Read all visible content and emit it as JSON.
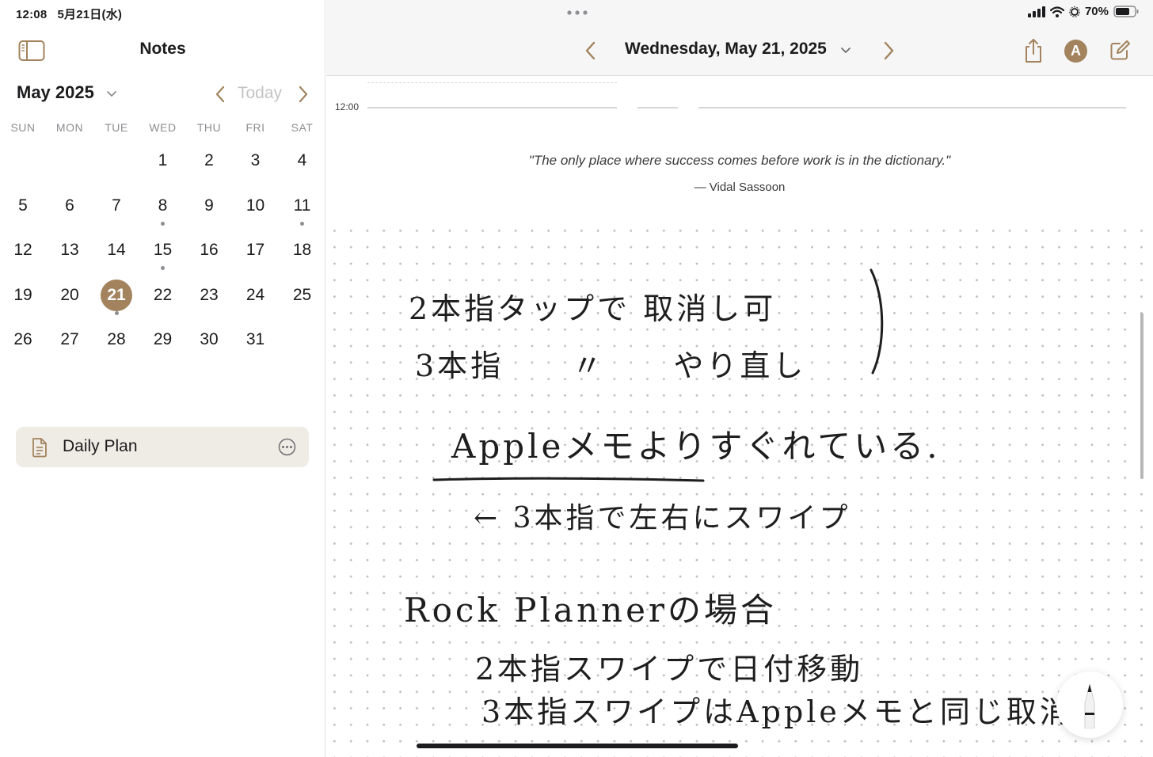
{
  "status_bar": {
    "time": "12:08",
    "date": "5月21日(水)",
    "battery": "70%"
  },
  "sidebar": {
    "title": "Notes",
    "month_label": "May 2025",
    "today_label": "Today",
    "weekdays": [
      "SUN",
      "MON",
      "TUE",
      "WED",
      "THU",
      "FRI",
      "SAT"
    ],
    "weeks": [
      [
        "",
        "",
        "",
        "1",
        "2",
        "3",
        "4"
      ],
      [
        "5",
        "6",
        "7",
        "8",
        "9",
        "10",
        "11"
      ],
      [
        "12",
        "13",
        "14",
        "15",
        "16",
        "17",
        "18"
      ],
      [
        "19",
        "20",
        "21",
        "22",
        "23",
        "24",
        "25"
      ],
      [
        "26",
        "27",
        "28",
        "29",
        "30",
        "31",
        ""
      ]
    ],
    "selected_day": "21",
    "days_with_dots": [
      "8",
      "11",
      "15",
      "21"
    ],
    "plan_item": {
      "label": "Daily Plan"
    }
  },
  "header": {
    "date": "Wednesday, May 21, 2025",
    "avatar_letter": "A"
  },
  "note": {
    "time_label": "12:00",
    "quote": "\"The only place where success comes before work is in the dictionary.\"",
    "quote_author": "— Vidal Sassoon",
    "handwriting": [
      "2本指タップで 取消し可",
      "3本指 〃 やり直し",
      "Appleメモよりすぐれている.",
      "← 3本指で左右にスワイプ",
      "Rock Plannerの場合",
      "2本指スワイプで日付移動",
      "3本指スワイプはAppleメモと同じ取消"
    ]
  },
  "icons": {
    "sidebar_toggle": "sidebar-icon",
    "share": "share-icon",
    "compose": "compose-icon",
    "pencil": "pencil-icon",
    "document": "document-icon",
    "more": "ellipsis-circle-icon"
  },
  "colors": {
    "accent": "#a2835d",
    "plan_card_bg": "#efebe5",
    "header_bg": "#f6f6f6"
  }
}
